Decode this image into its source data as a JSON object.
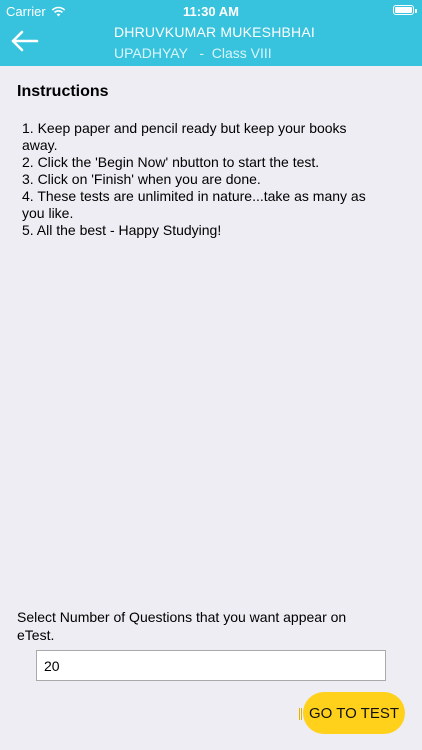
{
  "status_bar": {
    "carrier": "Carrier",
    "time": "11:30 AM",
    "wifi_icon": "wifi-icon",
    "battery_icon": "battery-icon",
    "battery_level": 1.0
  },
  "header": {
    "back_icon": "arrow-left-icon",
    "student_name": "DHRUVKUMAR MUKESHBHAI",
    "student_surname_class": "UPADHYAY   -  Class VIII"
  },
  "instructions": {
    "heading": "Instructions",
    "items": [
      "1. Keep paper and pencil ready but keep your books away.",
      "2. Click the 'Begin Now' nbutton to start the test.",
      "3. Click on 'Finish' when you are done.",
      "4. These tests are unlimited in nature...take as many as you like.",
      "5. All the best - Happy Studying!"
    ]
  },
  "question_selector": {
    "label": "Select Number of Questions that you want appear on eTest.",
    "value": "20"
  },
  "go_button_label": "GO TO TEST",
  "colors": {
    "header": "#37c3dd",
    "background": "#eeedf3",
    "button": "#ffd11a"
  }
}
